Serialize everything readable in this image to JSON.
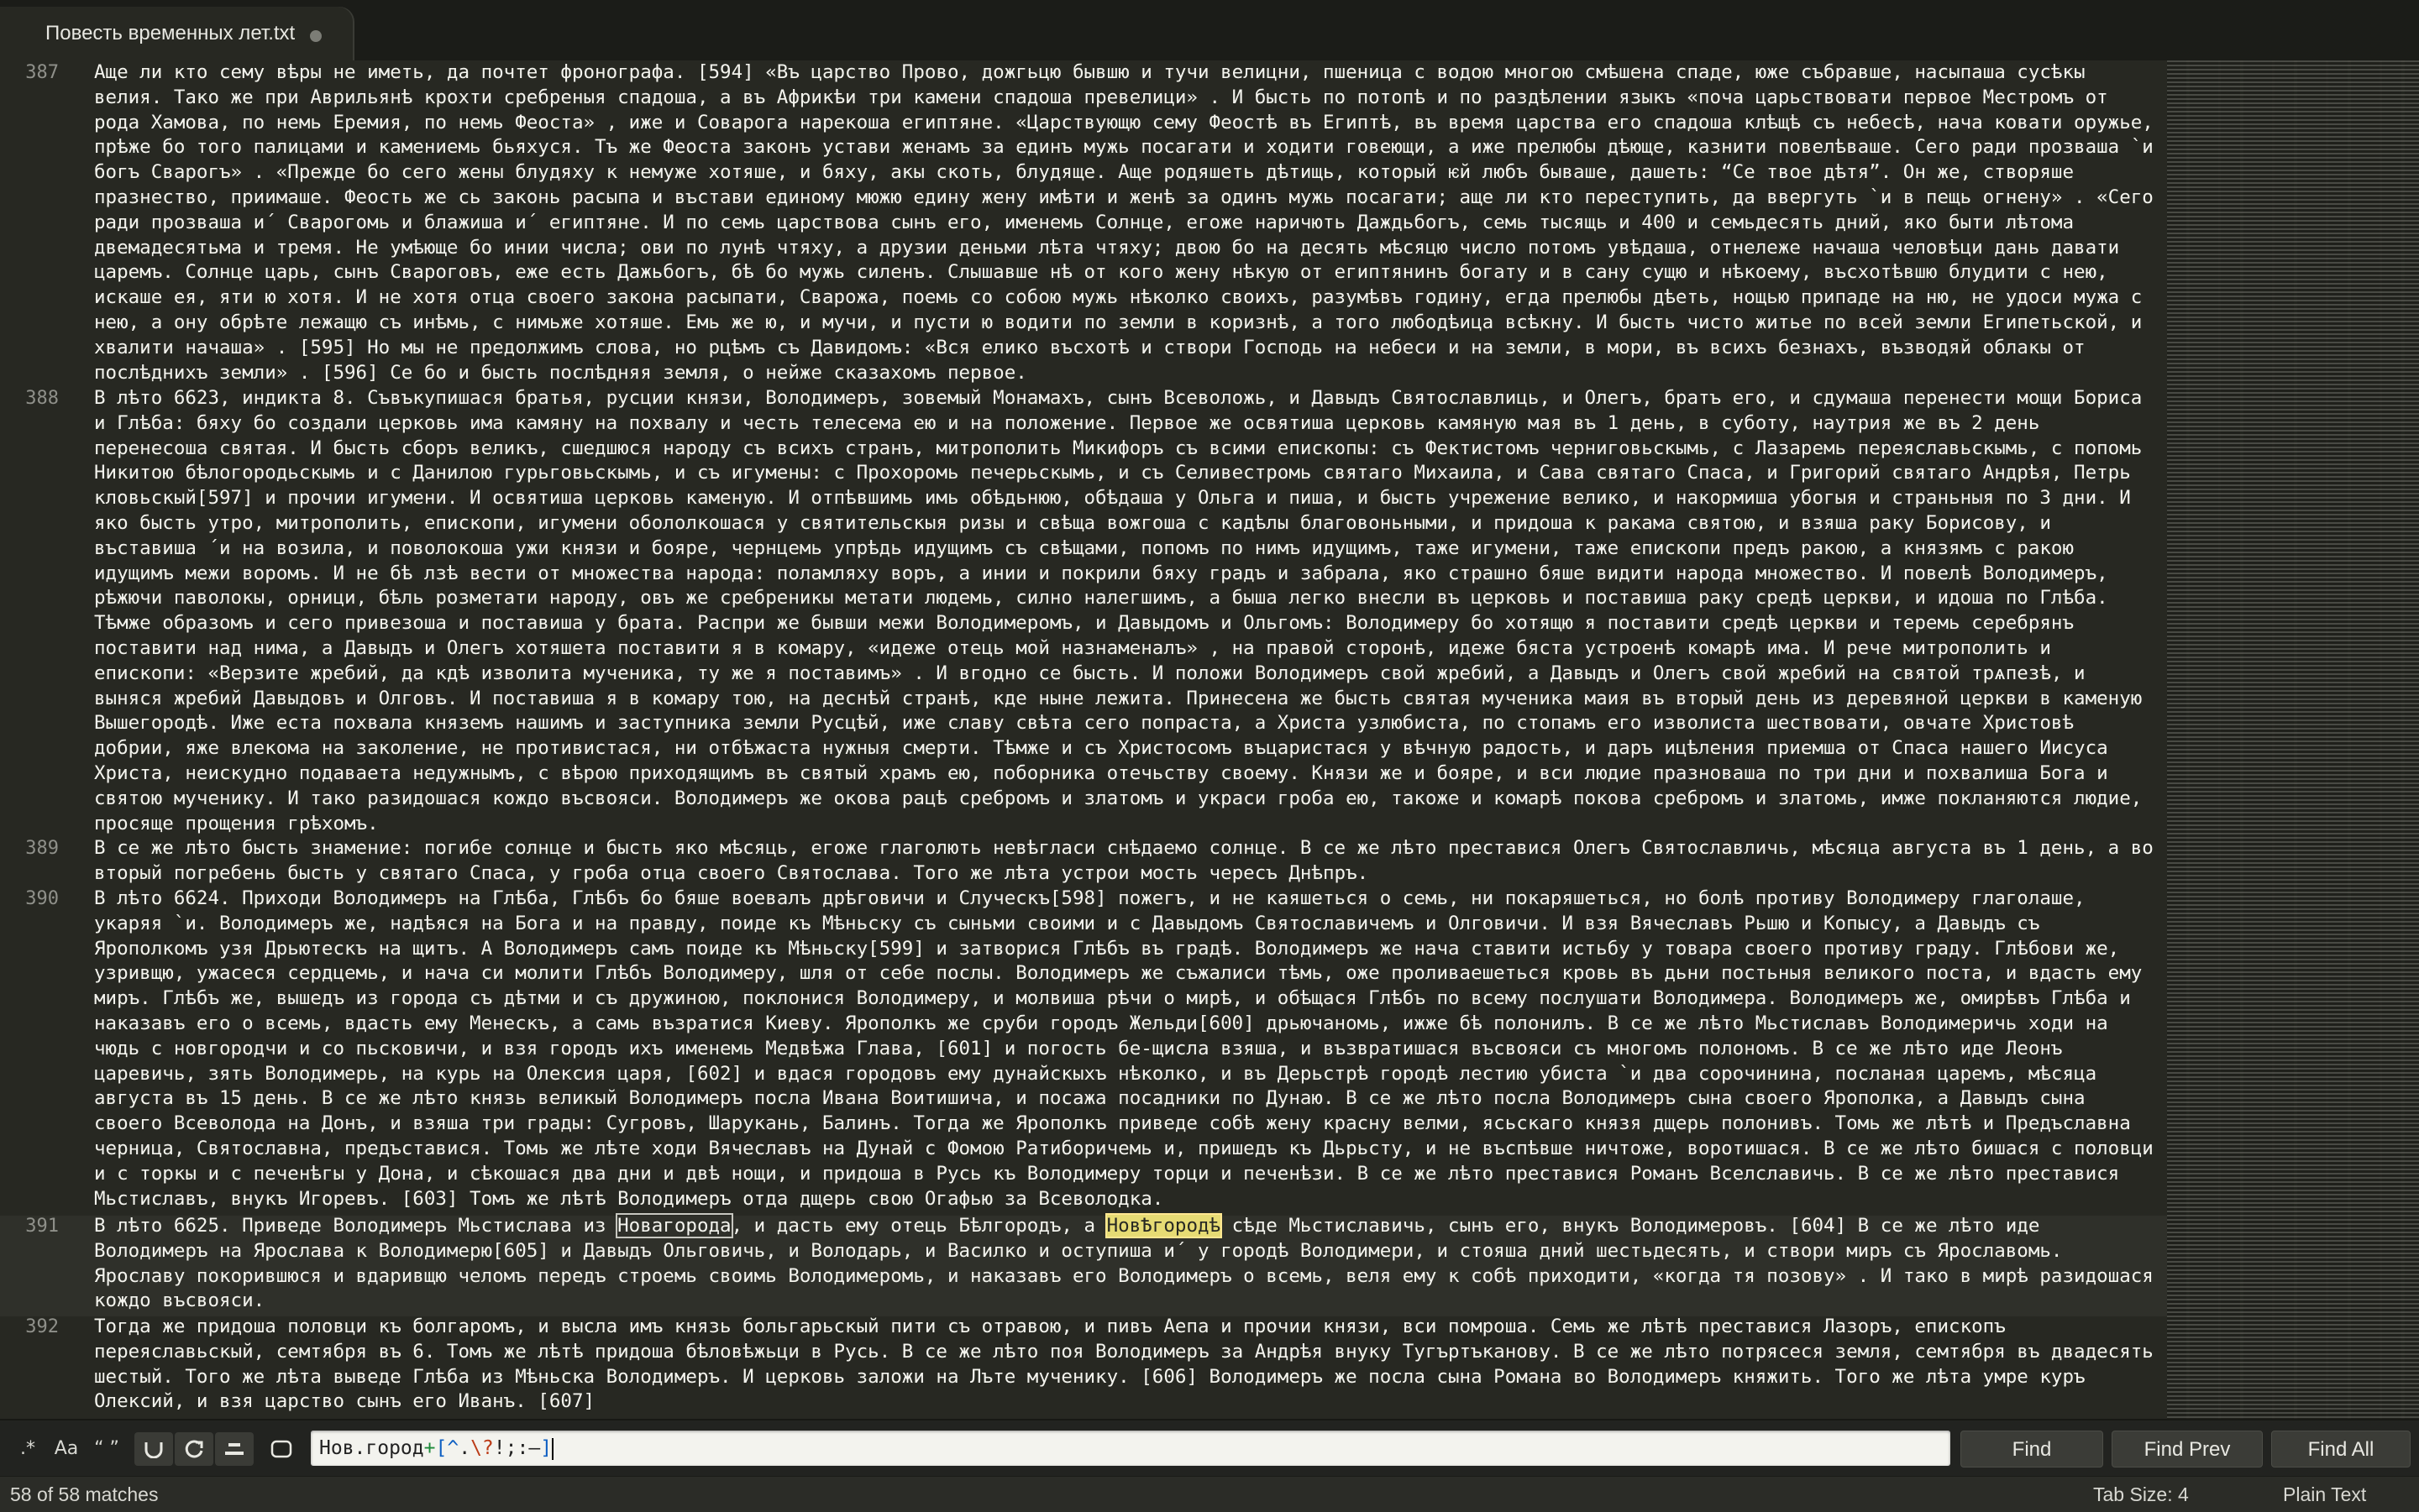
{
  "tab": {
    "title": "Повесть временных лет.txt"
  },
  "lines": [
    {
      "number": "387",
      "text": "Аще ли кто сему вѣры не иметь, да почтет фронографа. [594] «Въ царство Прово, дожгьцю бывшю и тучи велицни, пшеница с водою многою смѣшена спаде, юже събравше, насыпаша сусѣкы велия. Тако же при Аврильянѣ крохти сребреныя спадоша, а въ Африкѣи три камени спадоша превелици» . И бысть по потопѣ и по раздѣлении языкъ «поча царьствовати первое Местромъ от рода Хамова, по немь Еремия, по немь Феоста» , иже и Соварога нарекоша египтяне. «Царствующю сему Феостѣ въ Египтѣ, въ время царства его спадоша клѣщѣ съ небесѣ, нача ковати оружье, прѣже бо того палицами и камениемь бьяхуся. Тъ же Феоста законъ устави женамъ за единъ мужь посагати и ходити говеющи, а иже прелюбы дѣюще, казнити повелѣваше. Сего ради прозваша `и богъ Сварогъ» . «Прежде бо сего жены блудяху к немуже хотяше, и бяху, акы скоть, блудяще. Аще родяшеть дѣтищь, который ѥй любъ бываше, дашеть: “Се твое дѣтя”. Он же, створяше празнество, приимаше. Феость же сь законь расыпа и въстави единому мюжю едину жену имѣти и женѣ за одинъ мужь посагати; аще ли кто переступить, да ввергуть `и в пещь огнену» . «Сего ради прозваша и´ Сварогомь и блажиша и´ египтяне. И по семь царствова сынъ его, именемь Солнце, егоже наричють Даждьбогъ, семь тысящь и 400 и семьдесять дний, яко быти лѣтома двемадесятьма и тремя. Не умѣюще бо инии числа; ови по лунѣ чтяху, а друзии деньми лѣта чтяху; двою бо на десять мѣсяцю число потомъ увѣдаша, отнележе начаша человѣци дань давати царемъ. Солнце царь, сынъ Свароговъ, еже есть Дажьбогъ, бѣ бо мужь силенъ. Слышавше нѣ от кого жену нѣкую от египтянинъ богату и в сану сущю и нѣкоему, въсхотѣвшю блудити с нею, искаше ея, яти ю хотя. И не хотя отца своего закона расыпати, Сварожа, поемь со собою мужь нѣколко своихъ, разумѣвъ годину, егда прелюбы дѣеть, нощью припаде на ню, не удоси мужа с нею, а ону обрѣте лежащю съ инѣмь, с нимьже хотяше. Емь же ю, и мучи, и пусти ю водити по земли в коризнѣ, а того любодѣица всѣкну. И бысть чисто житье по всей земли Египетьской, и хвалити начаша» . [595] Но мы не предолжимъ слова, но рцѣмъ съ Давидомъ: «Вся елико въсхотѣ и створи Господь на небеси и на земли, в мори, въ всихъ безнахъ, възводяй облакы от послѣднихъ земли» . [596] Се бо и бысть послѣдняя земля, о нейже сказахомъ первое."
    },
    {
      "number": "388",
      "text": "В лѣто 6623, индикта 8. Съвъкупишася братья, русции князи, Володимеръ, зовемый Монамахъ, сынъ Всеволожь, и Давыдъ Святославлиць, и Олегъ, братъ его, и сдумаша перенести мощи Бориса и Глѣба: бяху бо создали церковь има камяну на похвалу и честь телесема ею и на положение. Первое же освятиша церковь камяную мая въ 1 день, в суботу, наутрия же въ 2 день перенесоша святая. И бысть сборъ великъ, сшедшюся народу съ всихъ странъ, митрополить Микифоръ съ всими епископы: съ Фектистомъ черниговьскымь, с Лазаремь переяславьскымь, с попомь Никитою бѣлогородьскымь и с Данилою гурьговьскымь, и съ игумены: с Прохоромь печерьскымь, и съ Селивестромь святаго Михаила, и Сава святаго Спаса, и Григорий святаго Андрѣя, Петрь кловьскый[597] и прочии игумени. И освятиша церковь каменую. И отпѣвшимь имь обѣдьнюю, обѣдаша у Ольга и пиша, и бысть учрежение велико, и накормиша убогыя и страньныя по 3 дни. И яко бысть утро, митрополить, епископи, игумени обололкошася у святительскыя ризы и свѣща вожгоша с кадѣлы благовоньными, и придоша к ракама святою, и взяша раку Борисову, и въставиша ´и на возила, и поволокоша ужи князи и бояре, чернцемь упрѣдь идущимъ съ свѣщами, попомъ по нимъ идущимъ, таже игумени, таже епископи предъ ракою, а князямъ с ракою идущимъ межи воромъ. И не бѣ лзѣ вести от множества народа: поламляху воръ, а инии и покрили бяху градъ и забрала, яко страшно бяше видити народа множество. И повелѣ Володимеръ, рѣжючи паволокы, орници, бѣль розметати народу, овъ же сребреникы метати людемь, силно налегшимъ, а быша легко внесли въ церковь и поставиша раку средѣ церкви, и идоша по Глѣба. Тѣмже образомъ и сего привезоша и поставиша у брата. Распри же бывши межи Володимеромъ, и Давыдомъ и Ольгомъ: Володимеру бо хотящю я поставити средѣ церкви и теремь серебрянъ поставити над нима, а Давыдъ и Олегъ хотяшета поставити я в комару, «идеже отець мой назнаменалъ» , на правой сторонѣ, идеже бяста устроенѣ комарѣ има. И рече митрополить и епископи: «Верзите жребий, да кдѣ изволита мученика, ту же я поставимъ» . И вгодно се бысть. И положи Володимеръ свой жребий, а Давыдъ и Олегъ свой жребий на святой трѧпезѣ, и выняся жребий Давыдовъ и Олговъ. И поставиша я в комару тою, на деснѣй странѣ, кде ныне лежита. Принесена же бысть святая мученика маия въ вторый день из деревяной церкви в каменую Вышегородѣ. Иже еста похвала княземъ нашимъ и заступника земли Русцѣй, иже славу свѣта сего попраста, а Христа узлюбиста, по стопамъ его изволиста шествовати, овчате Христовѣ добрии, яже влекома на заколение, не противистася, ни отбѣжаста нужныя смерти. Тѣмже и съ Христосомъ въцаристася у вѣчную радость, и даръ ицѣления приемша от Спаса нашего Иисуса Христа, неискудно подаваета недужнымъ, с вѣрою приходящимъ въ святый храмъ ею, поборника отечьству своему. Князи же и бояре, и вси людие празноваша по три дни и похвалиша Бога и святою мученику. И тако разидошася кождо въсвояси. Володимеръ же окова рацѣ сребромъ и златомъ и украси гроба ею, такоже и комарѣ покова сребромъ и златомь, имже покланяются людие, просяще прощения грѣхомъ."
    },
    {
      "number": "389",
      "text": "В се же лѣто бысть знамение: погибе солнце и бысть яко мѣсяць, егоже глаголють невѣгласи снѣдаемо солнце. В се же лѣто преставися Олегъ Святославличь, мѣсяца августа въ 1 день, а во вторый погребень бысть у святаго Спаса, у гроба отца своего Святослава. Того же лѣта устрои мость чересъ Днѣпръ."
    },
    {
      "number": "390",
      "text": "В лѣто 6624. Приходи Володимеръ на Глѣба, Глѣбъ бо бяше воевалъ дрѣговичи и Случескъ[598] пожегъ, и не каяшеться о семь, ни покаряшеться, но болѣ противу Володимеру глаголаше, укаряя `и. Володимеръ же, надѣяся на Бога и на правду, поиде къ Мѣньску съ сыньми своими и с Давыдомъ Святославичемъ и Олговичи. И взя Вячеславъ Рьшю и Копысу, а Давыдъ съ Ярополкомъ узя Дрьютескъ на щитъ. А Володимеръ самъ поиде къ Мѣньску[599] и затворися Глѣбъ въ градѣ. Володимеръ же нача ставити истьбу у товара своего противу граду. Глѣбови же, узривщю, ужасеся сердцемь, и нача си молити Глѣбъ Володимеру, шля от себе послы. Володимеръ же съжалиси тѣмь, оже проливаешеться кровь въ дьни постьныя великого поста, и вдасть ему миръ. Глѣбъ же, вышедъ из города съ дѣтми и съ дружиною, поклонися Володимеру, и молвиша рѣчи о мирѣ, и обѣщася Глѣбъ по всему послушати Володимера. Володимеръ же, омирѣвъ Глѣба и наказавъ его о всемь, вдасть ему Менескъ, а самь възратися Киеву. Ярополкъ же сруби городъ Жельди[600] дрьючаномь, ижже бѣ полонилъ. В се же лѣто Мьстиславъ Володимеричь ходи на чюдь с новгородчи и со пьсковичи, и взя городъ ихъ именемь Медвѣжа Глава, [601] и погость бе-щисла взяша, и възвратишася въсвояси съ многомъ полономъ. В се же лѣто иде Леонъ царевичь, зять Володимерь, на курь на Олексия царя, [602] и вдася городовъ ему дунайскыхъ нѣколко, и въ Дерьстрѣ городѣ лестию убиста `и два сорочинина, посланая царемъ, мѣсяца августа въ 15 день. В се же лѣто князь великый Володимеръ посла Ивана Воитишича, и посажа посадники по Дунаю. В се же лѣто посла Володимеръ сына своего Ярополка, а Давыдъ сына своего Всеволода на Донъ, и взяша три грады: Сугровъ, Шарукань, Балинъ. Тогда же Ярополкъ приведе собѣ жену красну велми, ясьскаго князя дщерь полонивъ. Томь же лѣтѣ и Предъславна черница, Святославна, предъставися. Томь же лѣте ходи Вячеславъ на Дунай с Фомою Ратиборичемь и, пришедъ къ Дьрьсту, и не въспѣвше ничтоже, воротишася. В се же лѣто бишася с половци и с торкы и с печенѣгы у Дона, и сѣкошася два дни и двѣ нощи, и придоша в Русь къ Володимеру торци и печенѣзи. В се же лѣто преставися Романъ Вселславичь. В се же лѣто преставися Мьстиславъ, внукъ Игоревъ. [603] Томъ же лѣтѣ Володимеръ отда дщерь свою Огафью за Всеволодка."
    },
    {
      "number": "391",
      "pre": "В лѣто 6625. Приведе Володимеръ Мьстислава из ",
      "match1": "Новагорода",
      "mid": ", и дасть ему отець Бѣлгородъ, а ",
      "match2": "НовѢгородѣ",
      "post": " сѣде Мьстиславичь, сынъ его, внукъ Володимеровъ. [604] В се же лѣто иде Володимеръ на Ярослава к Володимерю[605] и Давыдъ Ольговичь, и Володарь, и Василко и оступиша и´ у городѣ Володимери, и стояша дний шестьдесять, и створи миръ съ Ярославомь. Ярославу покорившюся и вдаривщю челомъ передъ строемь своимь Володимеромь, и наказавъ его Володимеръ о всемь, веля ему к собѣ приходити, «когда тя позову» . И тако в мирѣ разидошася кождо въсвояси."
    },
    {
      "number": "392",
      "text": "Тогда же придоша половци къ болгаромъ, и высла имъ князь больгарьскый пити съ отравою, и пивъ Аепа и прочии князи, вси помроша. Семь же лѣтѣ преставися Лазоръ, епископъ переяславьскый, семтября въ 6. Томъ же лѣтѣ придоша бѣловѣжьци в Русь. В се же лѣто поя Володимеръ за Андрѣя внуку Тугъртъканову. В се же лѣто потрясеся земля, семтября въ двадесять шестый. Того же лѣта выведе Глѣба из Мѣньска Володимеръ. И церковь заложи на Лъте мученику. [606] Володимеръ же посла сына Романа во Володимеръ княжить. Того же лѣта умре куръ Олексий, и взя царство сынъ его Иванъ. [607]"
    }
  ],
  "find": {
    "options": {
      "regex": ".*",
      "case": "Aa",
      "whole_word": "“ ”"
    },
    "query_parts": {
      "a": "Нов.город",
      "b": "+",
      "c": "[",
      "d": "^",
      "e": ".",
      "f": "\\?",
      "g": "!",
      "h": ";",
      "i": ":",
      "j": "–",
      "k": "]"
    },
    "find_label": "Find",
    "find_prev_label": "Find Prev",
    "find_all_label": "Find All"
  },
  "status": {
    "matches": "58 of 58 matches",
    "tab_size": "Tab Size: 4",
    "syntax": "Plain Text"
  },
  "colors": {
    "background": "#272822",
    "text": "#f4f4ee",
    "current_match": "#e6db74"
  }
}
